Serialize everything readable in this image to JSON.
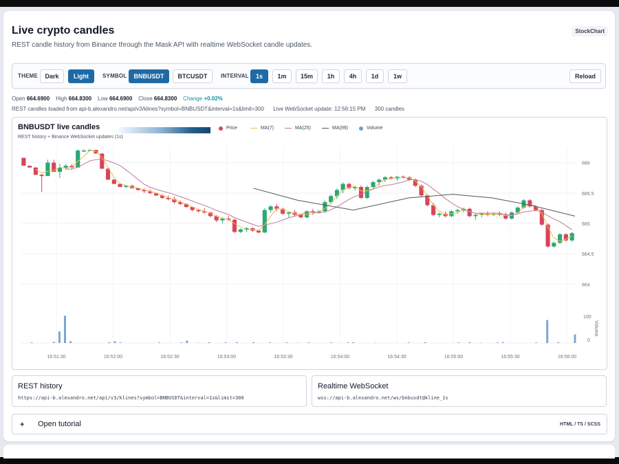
{
  "page": {
    "title": "Live crypto candles",
    "subtitle": "REST candle history from Binance through the Mask API with realtime WebSocket candle updates.",
    "badge": "StockChart"
  },
  "toolbar": {
    "theme_label": "THEME",
    "theme_options": [
      "Dark",
      "Light"
    ],
    "theme_selected": "Light",
    "symbol_label": "SYMBOL",
    "symbol_options": [
      "BNBUSDT",
      "BTCUSDT"
    ],
    "symbol_selected": "BNBUSDT",
    "interval_label": "INTERVAL",
    "interval_options": [
      "1s",
      "1m",
      "15m",
      "1h",
      "4h",
      "1d",
      "1w"
    ],
    "interval_selected": "1s",
    "reload_label": "Reload"
  },
  "stats": {
    "open_label": "Open",
    "open": "664.6900",
    "high_label": "High",
    "high": "664.8300",
    "low_label": "Low",
    "low": "664.6900",
    "close_label": "Close",
    "close": "664.8300",
    "change_label": "Change",
    "change": "+0.02%"
  },
  "status": {
    "rest": "REST candles loaded from api-b.alexandro.net/api/v3/klines?symbol=BNBUSDT&interval=1s&limit=300",
    "ws": "Live WebSocket update: 12:56:15 PM",
    "count": "300 candles"
  },
  "chart": {
    "title": "BNBUSDT live candles",
    "subtitle": "REST history + Binance WebSocket updates (1s)",
    "legend": [
      {
        "label": "Price",
        "kind": "dot",
        "color": "#d9435c"
      },
      {
        "label": "MA(7)",
        "kind": "line",
        "color": "#e8c14a"
      },
      {
        "label": "MA(25)",
        "kind": "line",
        "color": "#c07a9a"
      },
      {
        "label": "MA(99)",
        "kind": "line",
        "color": "#555555"
      },
      {
        "label": "Volume",
        "kind": "dot",
        "color": "#6f9fd0"
      }
    ],
    "colors": {
      "up": "#2aa876",
      "down": "#d9435c",
      "volume": "#7aa6d6"
    }
  },
  "chart_data": {
    "type": "candlestick",
    "y_ticks": [
      "666",
      "665.5",
      "665",
      "664.5",
      "664"
    ],
    "ylim": [
      663.8,
      666.2
    ],
    "volume_ticks": [
      "100",
      "0"
    ],
    "volume_axis_label": "Volume",
    "x_ticks": [
      "16:51:30",
      "16:52:00",
      "16:52:30",
      "16:53:00",
      "16:53:30",
      "16:54:00",
      "16:54:30",
      "16:55:00",
      "16:55:30",
      "16:56:00"
    ],
    "ohlc": [
      [
        666.08,
        666.08,
        665.95,
        665.95
      ],
      [
        665.95,
        665.95,
        665.92,
        665.92
      ],
      [
        665.92,
        665.93,
        665.8,
        665.8
      ],
      [
        665.8,
        665.82,
        665.52,
        665.78
      ],
      [
        665.78,
        666.05,
        665.95,
        666.0
      ],
      [
        666.0,
        666.05,
        665.85,
        665.85
      ],
      [
        665.85,
        665.98,
        665.75,
        665.92
      ],
      [
        665.92,
        665.98,
        665.88,
        665.95
      ],
      [
        665.95,
        665.98,
        665.9,
        665.92
      ],
      [
        665.92,
        666.22,
        665.92,
        666.2
      ],
      [
        666.2,
        666.22,
        666.18,
        666.2
      ],
      [
        666.2,
        666.22,
        666.19,
        666.21
      ],
      [
        666.21,
        666.21,
        666.15,
        666.15
      ],
      [
        666.15,
        666.16,
        665.9,
        665.9
      ],
      [
        665.9,
        665.92,
        665.72,
        665.72
      ],
      [
        665.72,
        665.73,
        665.65,
        665.65
      ],
      [
        665.65,
        665.66,
        665.6,
        665.6
      ],
      [
        665.6,
        665.63,
        665.58,
        665.62
      ],
      [
        665.62,
        665.64,
        665.57,
        665.58
      ],
      [
        665.58,
        665.59,
        665.54,
        665.55
      ],
      [
        665.55,
        665.58,
        665.5,
        665.53
      ],
      [
        665.53,
        665.56,
        665.48,
        665.5
      ],
      [
        665.5,
        665.51,
        665.45,
        665.46
      ],
      [
        665.46,
        665.48,
        665.4,
        665.42
      ],
      [
        665.42,
        665.46,
        665.38,
        665.4
      ],
      [
        665.4,
        665.44,
        665.32,
        665.35
      ],
      [
        665.35,
        665.38,
        665.3,
        665.32
      ],
      [
        665.32,
        665.33,
        665.26,
        665.27
      ],
      [
        665.27,
        665.28,
        665.2,
        665.22
      ],
      [
        665.22,
        665.24,
        665.18,
        665.2
      ],
      [
        665.2,
        665.25,
        665.16,
        665.18
      ],
      [
        665.18,
        665.19,
        665.1,
        665.12
      ],
      [
        665.12,
        665.14,
        665.02,
        665.05
      ],
      [
        665.05,
        665.1,
        665.0,
        665.08
      ],
      [
        665.08,
        665.12,
        665.04,
        665.06
      ],
      [
        665.06,
        665.08,
        664.84,
        664.86
      ],
      [
        664.86,
        664.92,
        664.84,
        664.9
      ],
      [
        664.9,
        664.94,
        664.86,
        664.92
      ],
      [
        664.92,
        664.94,
        664.86,
        664.88
      ],
      [
        664.88,
        664.89,
        664.84,
        664.85
      ],
      [
        664.85,
        665.25,
        664.84,
        665.22
      ],
      [
        665.22,
        665.3,
        665.18,
        665.28
      ],
      [
        665.28,
        665.32,
        665.2,
        665.24
      ],
      [
        665.24,
        665.26,
        665.14,
        665.16
      ],
      [
        665.16,
        665.2,
        665.1,
        665.18
      ],
      [
        665.18,
        665.22,
        665.12,
        665.14
      ],
      [
        665.14,
        665.16,
        665.08,
        665.1
      ],
      [
        665.1,
        665.22,
        665.08,
        665.2
      ],
      [
        665.2,
        665.24,
        665.14,
        665.18
      ],
      [
        665.18,
        665.22,
        665.16,
        665.2
      ],
      [
        665.2,
        665.38,
        665.18,
        665.35
      ],
      [
        665.35,
        665.48,
        665.32,
        665.45
      ],
      [
        665.45,
        665.58,
        665.4,
        665.55
      ],
      [
        665.55,
        665.68,
        665.5,
        665.65
      ],
      [
        665.65,
        665.67,
        665.56,
        665.58
      ],
      [
        665.58,
        665.62,
        665.54,
        665.6
      ],
      [
        665.6,
        665.63,
        665.4,
        665.42
      ],
      [
        665.42,
        665.62,
        665.4,
        665.6
      ],
      [
        665.6,
        665.7,
        665.56,
        665.68
      ],
      [
        665.68,
        665.74,
        665.62,
        665.72
      ],
      [
        665.72,
        665.78,
        665.68,
        665.76
      ],
      [
        665.76,
        665.78,
        665.72,
        665.74
      ],
      [
        665.74,
        665.78,
        665.7,
        665.77
      ],
      [
        665.77,
        665.79,
        665.74,
        665.76
      ],
      [
        665.76,
        665.78,
        665.7,
        665.72
      ],
      [
        665.72,
        665.74,
        665.6,
        665.62
      ],
      [
        665.62,
        665.64,
        665.44,
        665.46
      ],
      [
        665.46,
        665.48,
        665.28,
        665.3
      ],
      [
        665.3,
        665.34,
        665.12,
        665.14
      ],
      [
        665.14,
        665.18,
        665.1,
        665.16
      ],
      [
        665.16,
        665.2,
        665.1,
        665.12
      ],
      [
        665.12,
        665.22,
        665.1,
        665.2
      ],
      [
        665.2,
        665.24,
        665.16,
        665.22
      ],
      [
        665.22,
        665.26,
        665.18,
        665.24
      ],
      [
        665.24,
        665.26,
        665.1,
        665.12
      ],
      [
        665.12,
        665.16,
        665.06,
        665.14
      ],
      [
        665.14,
        665.18,
        665.1,
        665.16
      ],
      [
        665.16,
        665.2,
        665.12,
        665.14
      ],
      [
        665.14,
        665.18,
        665.12,
        665.16
      ],
      [
        665.16,
        665.2,
        665.12,
        665.14
      ],
      [
        665.14,
        665.18,
        665.06,
        665.08
      ],
      [
        665.08,
        665.2,
        665.06,
        665.18
      ],
      [
        665.18,
        665.28,
        665.16,
        665.26
      ],
      [
        665.26,
        665.4,
        665.24,
        665.38
      ],
      [
        665.38,
        665.4,
        665.26,
        665.28
      ],
      [
        665.28,
        665.3,
        665.2,
        665.22
      ],
      [
        665.22,
        665.24,
        664.96,
        664.98
      ],
      [
        664.98,
        665.0,
        664.6,
        664.62
      ],
      [
        664.62,
        664.7,
        664.6,
        664.68
      ],
      [
        664.68,
        664.84,
        664.66,
        664.82
      ],
      [
        664.82,
        664.84,
        664.7,
        664.72
      ],
      [
        664.72,
        664.86,
        664.7,
        664.84
      ]
    ],
    "ma99": [
      [
        0.42,
        665.58
      ],
      [
        0.5,
        665.38
      ],
      [
        0.6,
        665.22
      ],
      [
        0.7,
        665.42
      ],
      [
        0.78,
        665.48
      ],
      [
        0.85,
        665.42
      ],
      [
        0.92,
        665.3
      ],
      [
        1.0,
        665.12
      ]
    ],
    "volume": [
      [
        0.02,
        2
      ],
      [
        0.06,
        4
      ],
      [
        0.07,
        40
      ],
      [
        0.08,
        95
      ],
      [
        0.09,
        6
      ],
      [
        0.16,
        3
      ],
      [
        0.17,
        6
      ],
      [
        0.18,
        2
      ],
      [
        0.25,
        2
      ],
      [
        0.29,
        2
      ],
      [
        0.3,
        8
      ],
      [
        0.32,
        1
      ],
      [
        0.34,
        3
      ],
      [
        0.37,
        2
      ],
      [
        0.39,
        3
      ],
      [
        0.42,
        3
      ],
      [
        0.45,
        2
      ],
      [
        0.48,
        2
      ],
      [
        0.5,
        1
      ],
      [
        0.52,
        2
      ],
      [
        0.56,
        2
      ],
      [
        0.59,
        2
      ],
      [
        0.6,
        3
      ],
      [
        0.64,
        1
      ],
      [
        0.7,
        2
      ],
      [
        0.73,
        3
      ],
      [
        0.79,
        2
      ],
      [
        0.81,
        3
      ],
      [
        0.83,
        1
      ],
      [
        0.86,
        2
      ],
      [
        0.87,
        3
      ],
      [
        0.93,
        2
      ],
      [
        0.95,
        80
      ],
      [
        0.97,
        3
      ],
      [
        1.0,
        30
      ]
    ]
  },
  "panels": {
    "rest_title": "REST history",
    "rest_url": "https://api-b.alexandro.net/api/v3/klines?symbol=BNBUSDT&interval=1s&limit=300",
    "ws_title": "Realtime WebSocket",
    "ws_url": "wss://api-b.alexandro.net/ws/bnbusdt@kline_1s"
  },
  "tutorial": {
    "toggle_icon": "+",
    "title": "Open tutorial",
    "meta": "HTML / TS / SCSS"
  }
}
